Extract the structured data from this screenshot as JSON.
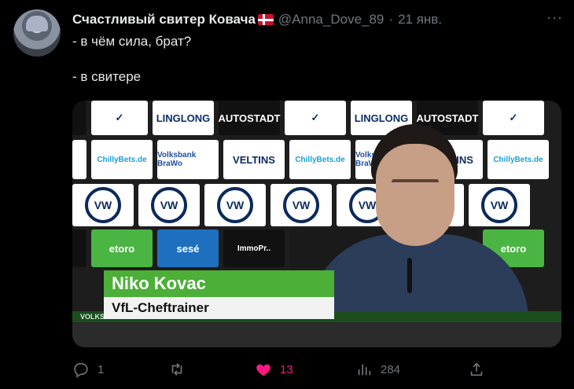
{
  "tweet": {
    "author_name": "Счастливый свитер Ковача",
    "handle": "@Anna_Dove_89",
    "separator": "·",
    "date": "21 янв.",
    "more": "···",
    "lines": [
      "- в чём сила, брат?",
      "- в свитере"
    ]
  },
  "media": {
    "board_top": [
      "LINGLONG",
      "AUTOSTADT",
      "LINGLONG",
      "AUTOSTADT"
    ],
    "board_mid": [
      "ChillyBets.de",
      "Volksbank BraWo",
      "VELTINS",
      "ChillyBets.de",
      "Volksbank BraWo",
      "VELTINS",
      "ChillyBets.de"
    ],
    "board_vw": [
      "VW",
      "VW",
      "VW",
      "VW",
      "VW",
      "VW",
      "VW"
    ],
    "board_low": [
      "etoro",
      "sesé",
      "ImmoPr..",
      "etoro"
    ],
    "name_caption": "Niko Kovac",
    "role_caption": "VfL-Cheftrainer",
    "arena_text": "VOLKSWAGEN ARENA"
  },
  "actions": {
    "reply_count": "1",
    "retweet_count": "",
    "like_count": "13",
    "views_count": "284"
  },
  "colors": {
    "background": "#000000",
    "text": "#e7e9ea",
    "muted": "#71767b",
    "like": "#f91880"
  }
}
